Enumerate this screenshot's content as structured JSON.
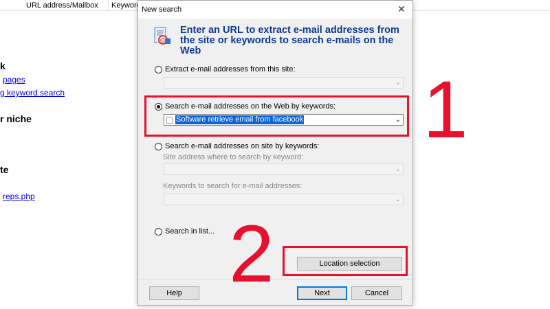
{
  "background": {
    "columns": [
      "URL address/Mailbox",
      "Keyword"
    ],
    "fragments": [
      {
        "text": "k",
        "style": "bold"
      },
      {
        "text": "pages",
        "style": "link"
      },
      {
        "text": "g keyword search",
        "style": "link"
      },
      {
        "text": "r niche",
        "style": "bold"
      },
      {
        "text": "te",
        "style": "bold"
      },
      {
        "text": "reps.php",
        "style": "link"
      }
    ]
  },
  "dialog": {
    "title": "New search",
    "close_symbol": "✕",
    "header": "Enter an URL to extract e-mail addresses from the site or keywords to search e-mails on the Web",
    "options": [
      {
        "label": "Extract e-mail addresses from this site:",
        "checked": false
      },
      {
        "label": "Search e-mail addresses on the Web by keywords:",
        "checked": true,
        "value": "Software retrieve email from facebook"
      },
      {
        "label": "Search e-mail addresses on site by keywords:",
        "checked": false,
        "site_label": "Site address where to search by keyword:",
        "keywords_label": "Keywords to search for e-mail addresses:"
      },
      {
        "label": "Search in list...",
        "checked": false
      }
    ],
    "location_button": "Location selection",
    "buttons": {
      "help": "Help",
      "next": "Next",
      "cancel": "Cancel"
    }
  },
  "annotations": {
    "one": "1",
    "two": "2",
    "color": "#e8102d"
  }
}
